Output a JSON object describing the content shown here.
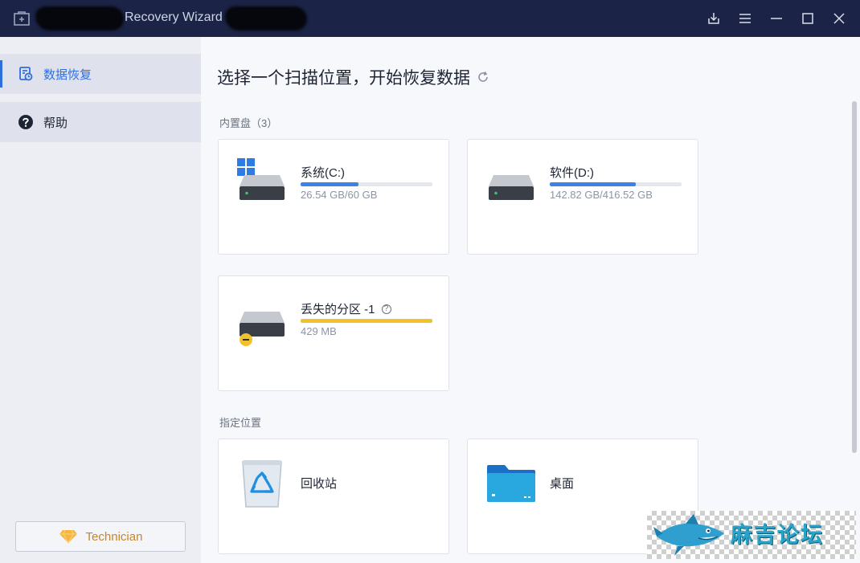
{
  "titlebar": {
    "title": "Recovery Wizard",
    "buttons": [
      "download-icon",
      "menu-icon",
      "minimize-icon",
      "maximize-icon",
      "close-icon"
    ]
  },
  "sidebar": {
    "items": [
      {
        "label": "数据恢复",
        "icon": "data-recovery-icon",
        "active": true
      },
      {
        "label": "帮助",
        "icon": "help-icon",
        "active": false
      }
    ],
    "technician_label": "Technician"
  },
  "main": {
    "title": "选择一个扫描位置，开始恢复数据",
    "internal_section": "内置盘（3）",
    "drives": [
      {
        "name": "系统(C:)",
        "size": "26.54 GB/60 GB",
        "used_fraction": 0.44,
        "bar_color": "#3c82e6",
        "windows": true
      },
      {
        "name": "软件(D:)",
        "size": "142.82 GB/416.52 GB",
        "used_fraction": 0.65,
        "bar_color": "#3c82e6",
        "windows": false
      },
      {
        "name": "丢失的分区 -1",
        "size": "429 MB",
        "used_fraction": 1.0,
        "bar_color": "#f2c12e",
        "lost": true
      }
    ],
    "location_section": "指定位置",
    "locations": [
      {
        "name": "回收站",
        "icon": "recycle-bin-icon"
      },
      {
        "name": "桌面",
        "icon": "folder-icon"
      }
    ]
  },
  "watermark": {
    "text": "麻吉论坛"
  },
  "colors": {
    "titlebar": "#1b2346",
    "accent": "#2e6fe0",
    "warning": "#f2c12e"
  }
}
